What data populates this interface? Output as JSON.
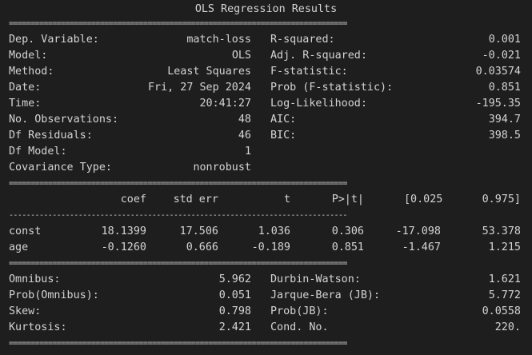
{
  "title": "OLS Regression Results",
  "separators": {
    "double": "==============================================================================",
    "single": "------------------------------------------------------------------------------"
  },
  "summary": [
    {
      "k1": "Dep. Variable:",
      "v1": "match-loss",
      "k2": "R-squared:",
      "v2": "0.001"
    },
    {
      "k1": "Model:",
      "v1": "OLS",
      "k2": "Adj. R-squared:",
      "v2": "-0.021"
    },
    {
      "k1": "Method:",
      "v1": "Least Squares",
      "k2": "F-statistic:",
      "v2": "0.03574"
    },
    {
      "k1": "Date:",
      "v1": "Fri, 27 Sep 2024",
      "k2": "Prob (F-statistic):",
      "v2": "0.851"
    },
    {
      "k1": "Time:",
      "v1": "20:41:27",
      "k2": "Log-Likelihood:",
      "v2": "-195.35"
    },
    {
      "k1": "No. Observations:",
      "v1": "48",
      "k2": "AIC:",
      "v2": "394.7"
    },
    {
      "k1": "Df Residuals:",
      "v1": "46",
      "k2": "BIC:",
      "v2": "398.5"
    },
    {
      "k1": "Df Model:",
      "v1": "1",
      "k2": "",
      "v2": ""
    },
    {
      "k1": "Covariance Type:",
      "v1": "nonrobust",
      "k2": "",
      "v2": ""
    }
  ],
  "coef_table": {
    "headers": [
      "coef",
      "std err",
      "t",
      "P>|t|",
      "[0.025",
      "0.975]"
    ],
    "rows": [
      {
        "name": "const",
        "values": [
          "18.1399",
          "17.506",
          "1.036",
          "0.306",
          "-17.098",
          "53.378"
        ]
      },
      {
        "name": "age",
        "values": [
          "-0.1260",
          "0.666",
          "-0.189",
          "0.851",
          "-1.467",
          "1.215"
        ]
      }
    ]
  },
  "diagnostics": [
    {
      "k1": "Omnibus:",
      "v1": "5.962",
      "k2": "Durbin-Watson:",
      "v2": "1.621"
    },
    {
      "k1": "Prob(Omnibus):",
      "v1": "0.051",
      "k2": "Jarque-Bera (JB):",
      "v2": "5.772"
    },
    {
      "k1": "Skew:",
      "v1": "0.798",
      "k2": "Prob(JB):",
      "v2": "0.0558"
    },
    {
      "k1": "Kurtosis:",
      "v1": "2.421",
      "k2": "Cond. No.",
      "v2": "220."
    }
  ],
  "colors": {
    "background": "#1e1e1e",
    "text": "#d4d4d4"
  }
}
